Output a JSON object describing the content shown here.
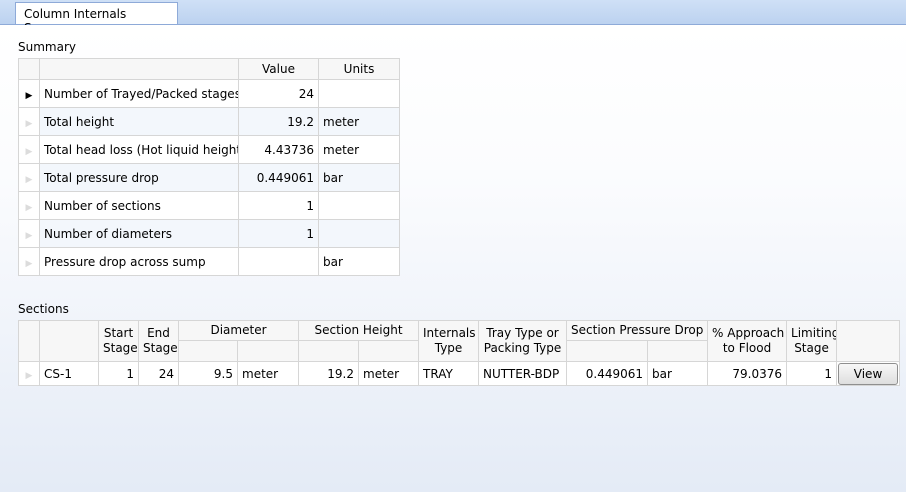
{
  "tab": {
    "label": "Column Internals Summary"
  },
  "summary": {
    "label": "Summary",
    "col_value": "Value",
    "col_units": "Units",
    "rows": [
      {
        "label": "Number of Trayed/Packed stages",
        "value": "24",
        "units": ""
      },
      {
        "label": "Total height",
        "value": "19.2",
        "units": "meter"
      },
      {
        "label": "Total head loss (Hot liquid height)",
        "value": "4.43736",
        "units": "meter"
      },
      {
        "label": "Total pressure drop",
        "value": "0.449061",
        "units": "bar"
      },
      {
        "label": "Number of sections",
        "value": "1",
        "units": ""
      },
      {
        "label": "Number of diameters",
        "value": "1",
        "units": ""
      },
      {
        "label": "Pressure drop across sump",
        "value": "",
        "units": "bar"
      }
    ]
  },
  "sections": {
    "label": "Sections",
    "headers": {
      "start_stage": [
        "Start",
        "Stage"
      ],
      "end_stage": [
        "End",
        "Stage"
      ],
      "diameter": "Diameter",
      "section_height": "Section Height",
      "internals_type": [
        "Internals",
        "Type"
      ],
      "tray_type": [
        "Tray Type or",
        "Packing Type"
      ],
      "section_pressure_drop": "Section Pressure Drop",
      "approach_flood": [
        "% Approach",
        "to Flood"
      ],
      "limiting_stage": [
        "Limiting",
        "Stage"
      ]
    },
    "rows": [
      {
        "name": "CS-1",
        "start_stage": "1",
        "end_stage": "24",
        "diameter": "9.5",
        "diameter_units": "meter",
        "section_height": "19.2",
        "section_height_units": "meter",
        "internals_type": "TRAY",
        "tray_type": "NUTTER-BDP",
        "section_pressure_drop": "0.449061",
        "section_pressure_drop_units": "bar",
        "approach_flood": "79.0376",
        "limiting_stage": "1",
        "view_label": "View"
      }
    ]
  }
}
